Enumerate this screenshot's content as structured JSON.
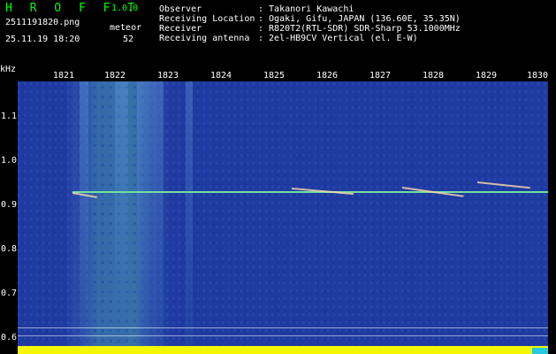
{
  "header": {
    "app_title": "H R O F F T",
    "version": "1.0.0",
    "file_name": "2511191820.png",
    "datetime": "25.11.19 18:20",
    "meteor_label": "meteor",
    "meteor_count": "52"
  },
  "metadata": [
    {
      "label": "Observer",
      "value": ": Takanori Kawachi"
    },
    {
      "label": "Receiving Location",
      "value": ": Ogaki, Gifu, JAPAN (136.60E, 35.35N)"
    },
    {
      "label": "Receiver",
      "value": ": R820T2(RTL-SDR) SDR-Sharp 53.1000MHz"
    },
    {
      "label": "Receiving antenna",
      "value": ": 2el-HB9CV Vertical (el. E-W)"
    }
  ],
  "axes": {
    "y_unit": "kHz",
    "y_ticks": [
      "1.1",
      "1.0",
      "0.9",
      "0.8",
      "0.7",
      "0.6"
    ],
    "x_ticks": [
      "1821",
      "1822",
      "1823",
      "1824",
      "1825",
      "1826",
      "1827",
      "1828",
      "1829",
      "1830"
    ]
  },
  "colors": {
    "background": "#000000",
    "spectrogram": "#1f3aa0",
    "title": "#00ff00",
    "text": "#ffffff",
    "signal": "#6fe0a0",
    "level_yellow": "#f5f700",
    "level_cyan": "#26c9e0"
  }
}
